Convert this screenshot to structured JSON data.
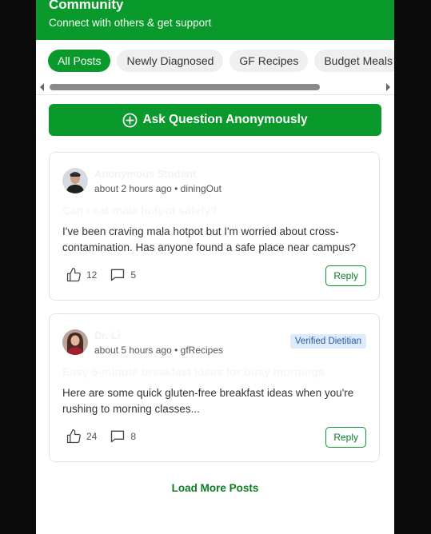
{
  "header": {
    "title": "Community",
    "subtitle": "Connect with others & get support"
  },
  "tabs": [
    {
      "label": "All Posts",
      "active": true
    },
    {
      "label": "Newly Diagnosed",
      "active": false
    },
    {
      "label": "GF Recipes",
      "active": false
    },
    {
      "label": "Budget Meals",
      "active": false
    }
  ],
  "ask_button": {
    "label": "Ask Question Anonymously",
    "icon": "plus-circle-icon"
  },
  "posts": [
    {
      "author": "Anonymous Student",
      "time": "about 2 hours ago",
      "tag": "diningOut",
      "badge": "",
      "title": "Can I eat mala hotpot safely?",
      "body": "I've been craving mala hotpot but I'm worried about cross-contamination. Has anyone found a safe place near campus?",
      "likes": "12",
      "comments": "5",
      "reply_label": "Reply"
    },
    {
      "author": "Dr. Li",
      "time": "about 5 hours ago",
      "tag": "gfRecipes",
      "badge": "Verified Dietitian",
      "title": "Easy 5-minute breakfast ideas for busy mornings",
      "body": "Here are some quick gluten-free breakfast ideas when you're rushing to morning classes...",
      "likes": "24",
      "comments": "8",
      "reply_label": "Reply"
    }
  ],
  "load_more": "Load More Posts",
  "colors": {
    "brand": "#0a9a2b",
    "badge_bg": "#deebfb",
    "badge_text": "#2a5ca8"
  }
}
